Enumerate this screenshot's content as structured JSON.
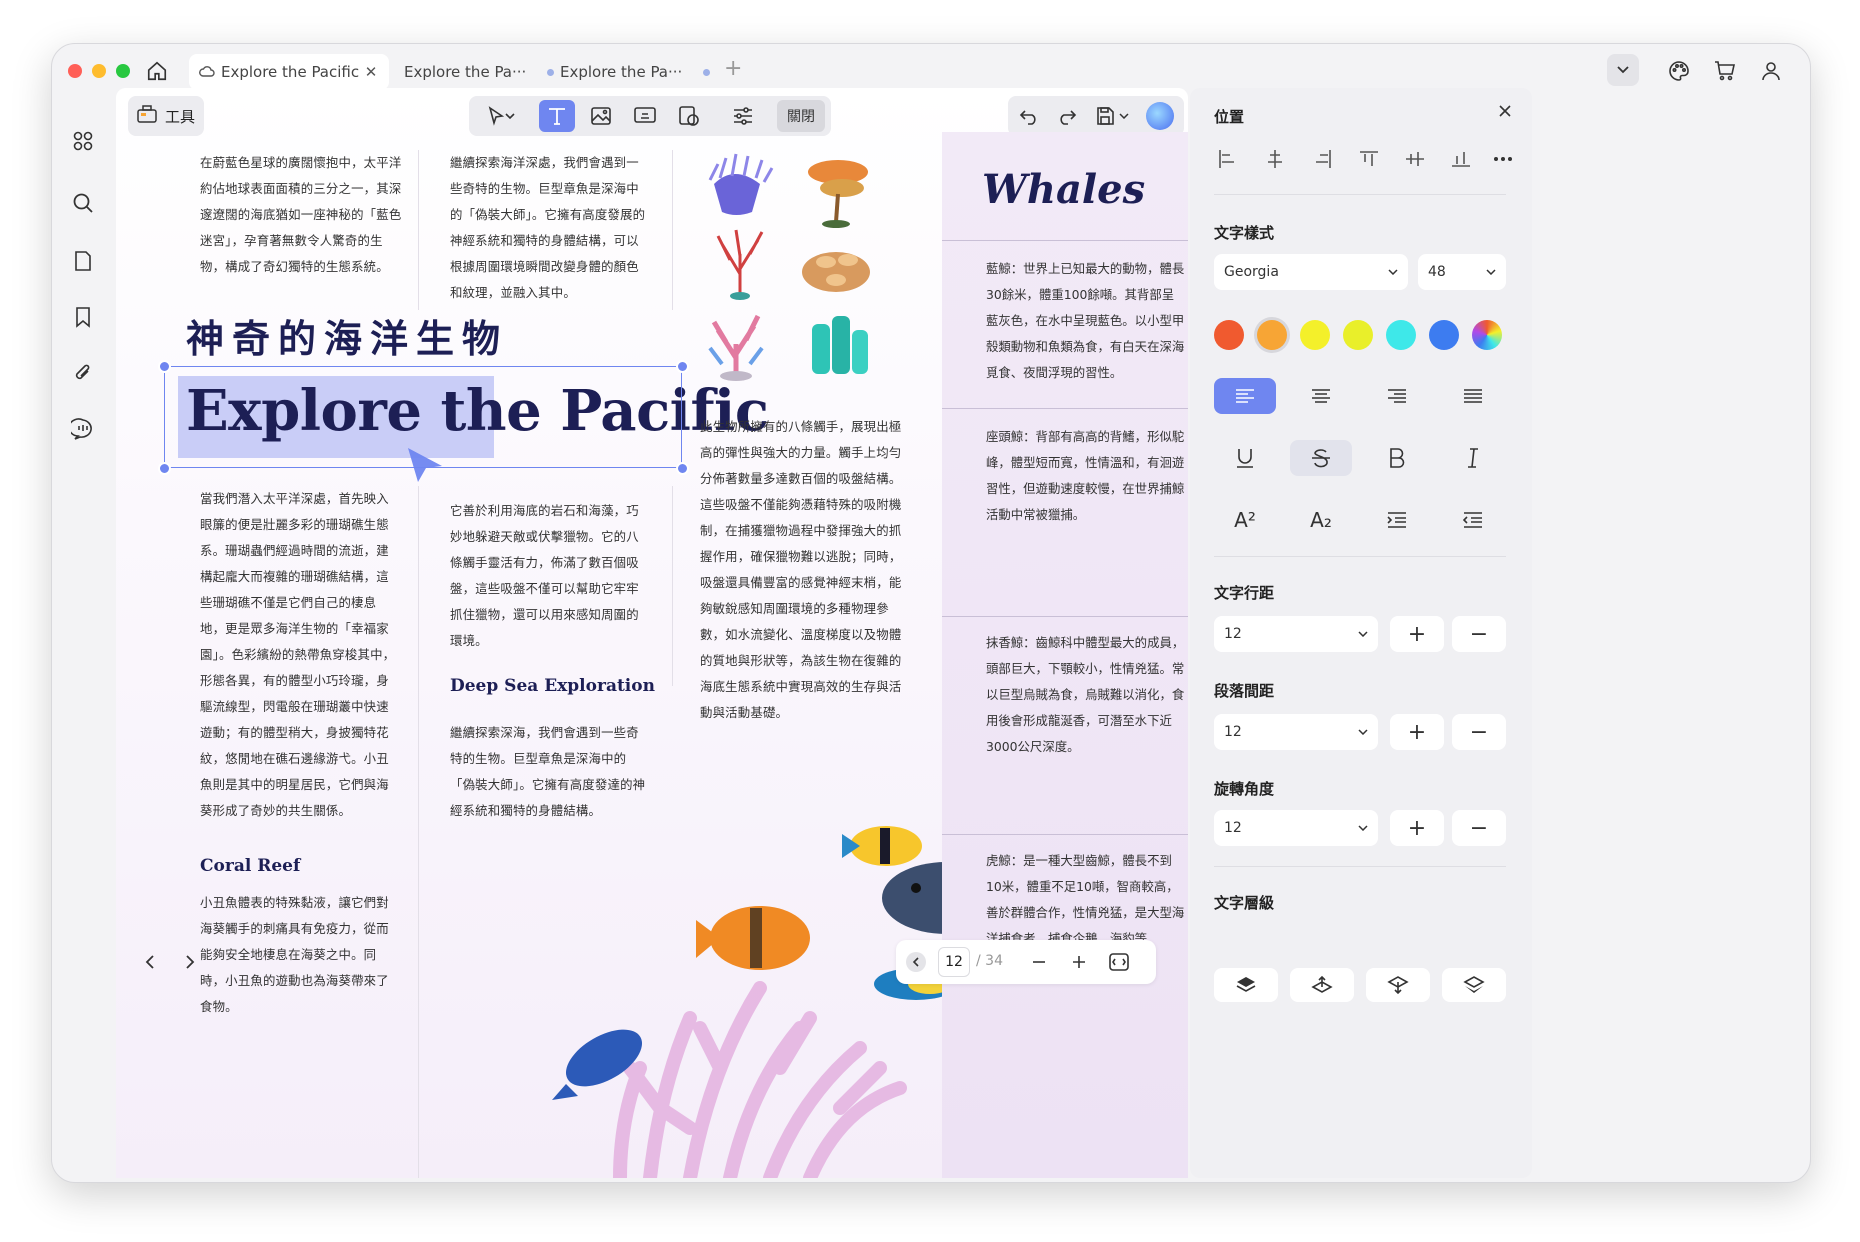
{
  "tabs": [
    {
      "label": "Explore the Pacific",
      "active": true
    },
    {
      "label": "Explore the Pa···",
      "active": false
    },
    {
      "label": "Explore the Pa···",
      "active": false
    }
  ],
  "toolbar": {
    "tools_label": "工具",
    "close_label": "關閉",
    "accent": "#6f86f0"
  },
  "doc": {
    "col1_top": "在蔚藍色星球的廣闊懷抱中，太平洋約佔地球表面面積的三分之一，其深邃遼闊的海底猶如一座神秘的「藍色迷宮」，孕育著無數令人驚奇的生物，構成了奇幻獨特的生態系統。",
    "col2_top": "繼續探索海洋深處，我們會遇到一些奇特的生物。巨型章魚是深海中的「偽裝大師」。它擁有高度發展的神經系統和獨特的身體結構，可以根據周圍環境瞬間改變身體的顏色和紋理，並融入其中。",
    "cn_title": "神奇的海洋生物",
    "en_title": "Explore the Pacific",
    "col1_mid": "當我們潛入太平洋深處，首先映入眼簾的便是壯麗多彩的珊瑚礁生態系。珊瑚蟲們經過時間的流逝，建構起龐大而複雜的珊瑚礁結構，這些珊瑚礁不僅是它們自己的棲息地，更是眾多海洋生物的「幸福家園」。色彩繽紛的熱帶魚穿梭其中，形態各異，有的體型小巧玲瓏，身驅流線型，閃電般在珊瑚叢中快速遊動；有的體型稍大，身披獨特花紋，悠閒地在礁石邊緣游弋。小丑魚則是其中的明星居民，它們與海葵形成了奇妙的共生關係。",
    "coral_heading": "Coral Reef",
    "coral_text": "小丑魚體表的特殊黏液，讓它們對海葵觸手的刺痛具有免疫力，從而能夠安全地棲息在海葵之中。同時，小丑魚的遊動也為海葵帶來了食物。",
    "col2_mid": "它善於利用海底的岩石和海藻，巧妙地躲避天敵或伏擊獵物。它的八條觸手靈活有力，佈滿了數百個吸盤，這些吸盤不僅可以幫助它牢牢抓住獵物，還可以用來感知周圍的環境。",
    "deep_heading": "Deep Sea Exploration",
    "deep_text": "繼續探索深海，我們會遇到一些奇特的生物。巨型章魚是深海中的「偽裝大師」。它擁有高度發達的神經系統和獨特的身體結構。",
    "col3_text": "此生物所擁有的八條觸手，展現出極高的彈性與強大的力量。觸手上均勻分佈著數量多達數百個的吸盤結構。這些吸盤不僅能夠憑藉特殊的吸附機制，在捕獲獵物過程中發揮強大的抓握作用，確保獵物難以逃脫；同時，吸盤還具備豐富的感覺神經末梢，能夠敏銳感知周圍環境的多種物理參數，如水流變化、溫度梯度以及物體的質地與形狀等，為該生物在復雜的海底生態系統中實現高效的生存與活動與活動基礎。"
  },
  "whales": {
    "title": "Whales",
    "p1": "藍鯨：世界上已知最大的動物，體長30餘米，體重100餘噸。其背部呈藍灰色，在水中呈現藍色。以小型甲殼類動物和魚類為食，有白天在深海覓食、夜間浮現的習性。",
    "p2": "座頭鯨：背部有高高的背鰭，形似駝峰，體型短而寬，性情溫和，有洄遊習性，但遊動速度較慢，在世界捕鯨活動中常被獵捕。",
    "p3": "抹香鯨：齒鯨科中體型最大的成員，頭部巨大，下顎較小，性情兇猛。常以巨型烏賊為食，烏賊難以消化，食用後會形成龍涎香，可潛至水下近3000公尺深度。",
    "p4": "虎鯨：是一種大型齒鯨，體長不到10米，體重不足10噸，智商較高，善於群體合作，性情兇猛，是大型海洋捕食者，捕食企鵝、海豹等"
  },
  "pager": {
    "current": "12",
    "total": "/ 34"
  },
  "panel": {
    "position_title": "位置",
    "text_style_title": "文字樣式",
    "font_family": "Georgia",
    "font_size": "48",
    "colors": [
      "#f05a2f",
      "#f7a535",
      "#f4f02a",
      "#e9ef2a",
      "#3ee8e9",
      "#3d7cf0"
    ],
    "line_spacing_title": "文字行距",
    "line_spacing_value": "12",
    "para_spacing_title": "段落間距",
    "para_spacing_value": "12",
    "rotation_title": "旋轉角度",
    "rotation_value": "12",
    "layer_title": "文字層級",
    "superscript_label": "A²",
    "subscript_label": "A₂"
  }
}
